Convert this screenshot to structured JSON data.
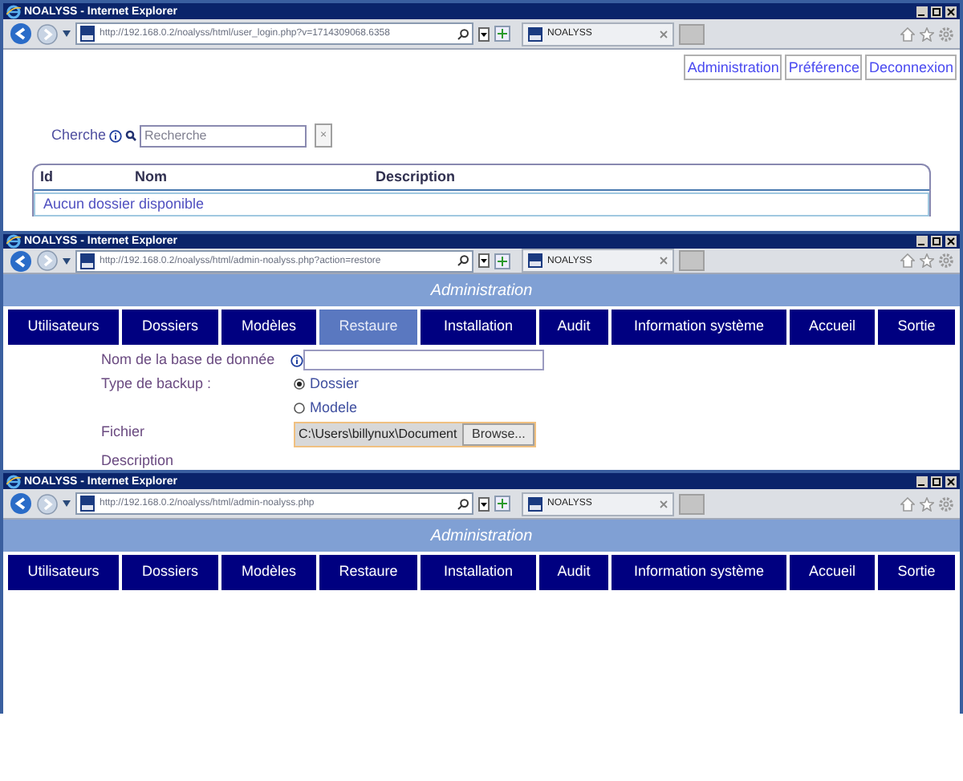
{
  "windows": [
    {
      "kind": "user_login",
      "title": "NOALYSS - Internet Explorer",
      "address": "http://192.168.0.2/noalyss/html/user_login.php?v=1714309068.6358",
      "tab": "NOALYSS",
      "top_links": [
        "Administration",
        "Préférence",
        "Deconnexion"
      ],
      "search": {
        "label": "Cherche",
        "placeholder": "Recherche",
        "clear": "×"
      },
      "table": {
        "columns": [
          "Id",
          "Nom",
          "Description"
        ],
        "empty_message": "Aucun dossier disponible"
      }
    },
    {
      "kind": "admin",
      "title": "NOALYSS - Internet Explorer",
      "address": "http://192.168.0.2/noalyss/html/admin-noalyss.php?action=restore",
      "tab": "NOALYSS",
      "banner": "Administration",
      "nav": [
        {
          "label": "Utilisateurs",
          "selected": false
        },
        {
          "label": "Dossiers",
          "selected": false
        },
        {
          "label": "Modèles",
          "selected": false
        },
        {
          "label": "Restaure",
          "selected": true
        },
        {
          "label": "Installation",
          "selected": false
        },
        {
          "label": "Audit",
          "selected": false
        },
        {
          "label": "Information système",
          "selected": false
        },
        {
          "label": "Accueil",
          "selected": false
        },
        {
          "label": "Sortie",
          "selected": false
        }
      ],
      "form": {
        "db_name_label": "Nom de la base de donnée",
        "backup_type_label": "Type de backup :",
        "backup_options": [
          {
            "label": "Dossier",
            "selected": true
          },
          {
            "label": "Modele",
            "selected": false
          }
        ],
        "file_label": "Fichier",
        "file_path": "C:\\Users\\billynux\\Document",
        "browse_button": "Browse...",
        "description_label": "Description"
      }
    },
    {
      "kind": "admin",
      "title": "NOALYSS - Internet Explorer",
      "address": "http://192.168.0.2/noalyss/html/admin-noalyss.php",
      "tab": "NOALYSS",
      "banner": "Administration",
      "nav": [
        {
          "label": "Utilisateurs",
          "selected": false
        },
        {
          "label": "Dossiers",
          "selected": false
        },
        {
          "label": "Modèles",
          "selected": false
        },
        {
          "label": "Restaure",
          "selected": false
        },
        {
          "label": "Installation",
          "selected": false
        },
        {
          "label": "Audit",
          "selected": false
        },
        {
          "label": "Information système",
          "selected": false
        },
        {
          "label": "Accueil",
          "selected": false
        },
        {
          "label": "Sortie",
          "selected": false
        }
      ]
    }
  ]
}
